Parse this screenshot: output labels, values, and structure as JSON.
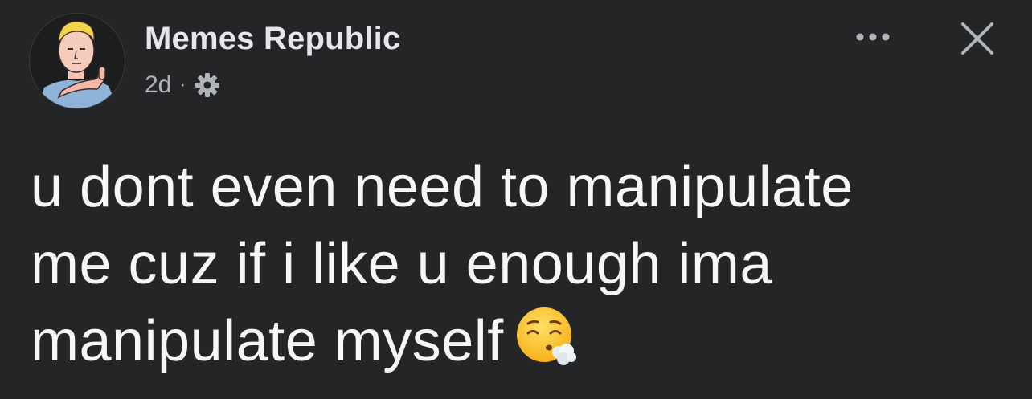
{
  "post": {
    "author": {
      "name": "Memes Republic",
      "avatar_icon": "cartoon-thumbs-up-man-avatar"
    },
    "meta": {
      "time": "2d",
      "separator": "·",
      "audience_icon": "gear-icon"
    },
    "actions": {
      "more_icon": "more-horizontal-icon",
      "close_icon": "close-icon"
    },
    "text_lines": [
      "u dont even need to manipulate",
      "me cuz if i like u enough ima",
      "manipulate myself"
    ],
    "emoji": "face-exhaling-emoji"
  },
  "colors": {
    "background": "#242526",
    "primary_text": "#e4e6eb",
    "secondary_text": "#b0b3b8"
  }
}
